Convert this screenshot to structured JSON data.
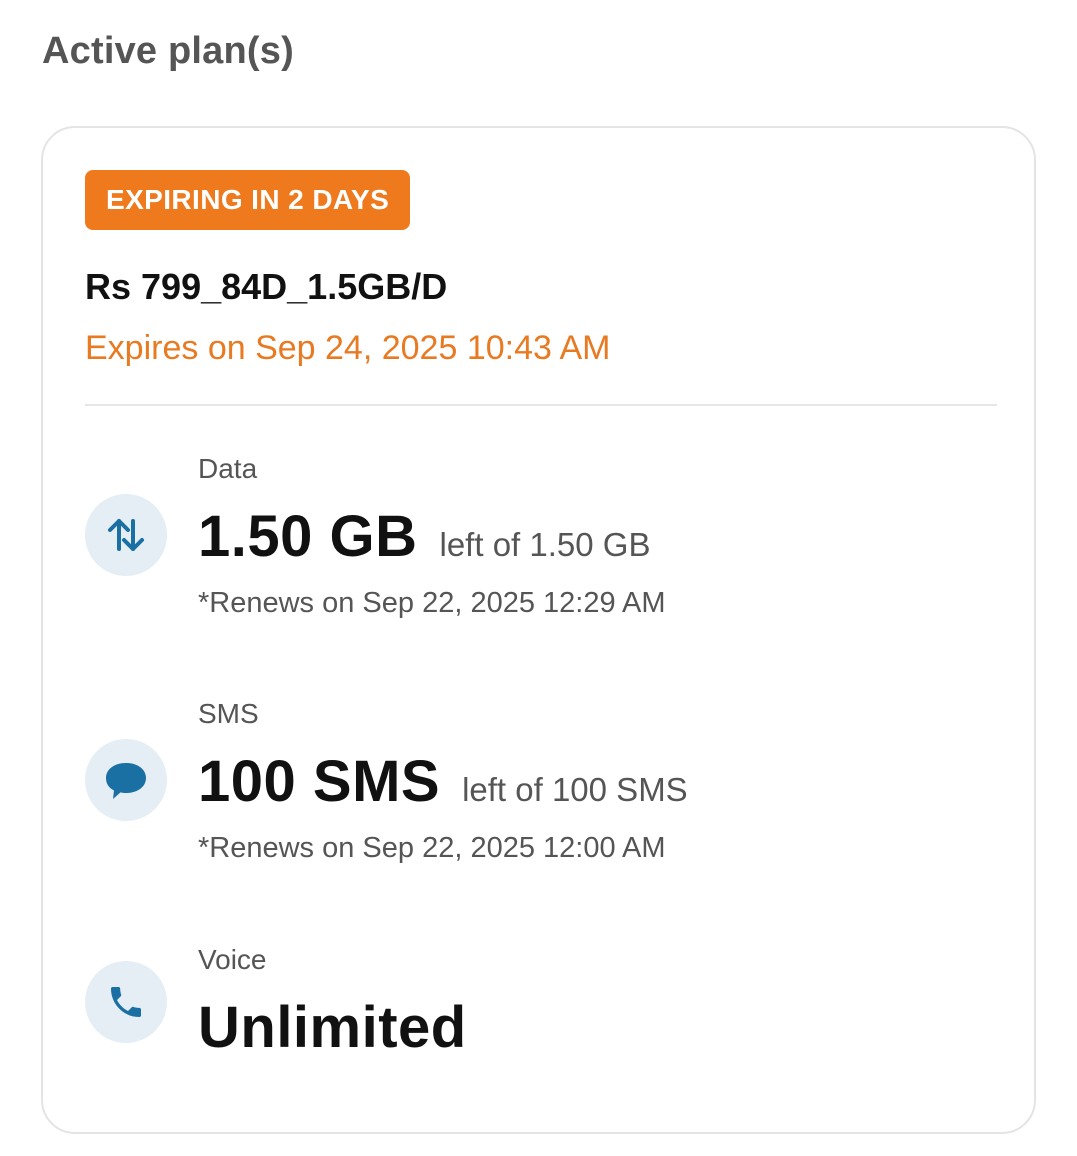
{
  "section_title": "Active plan(s)",
  "plan": {
    "badge": "EXPIRING IN 2 DAYS",
    "name": "Rs 799_84D_1.5GB/D",
    "expires": "Expires on Sep 24, 2025 10:43 AM"
  },
  "benefits": [
    {
      "label": "Data",
      "icon": "data-transfer-icon",
      "value": "1.50 GB",
      "of_text": "left of 1.50 GB",
      "renews": "*Renews on Sep 22, 2025 12:29 AM"
    },
    {
      "label": "SMS",
      "icon": "chat-bubble-icon",
      "value": "100 SMS",
      "of_text": "left of 100 SMS",
      "renews": "*Renews on Sep 22, 2025 12:00 AM"
    },
    {
      "label": "Voice",
      "icon": "phone-icon",
      "value": "Unlimited"
    }
  ],
  "colors": {
    "badge_bg": "#ef7a1d",
    "expires_text": "#e87a22",
    "icon_color": "#1a6fa3",
    "icon_bg": "#e5eef5"
  }
}
